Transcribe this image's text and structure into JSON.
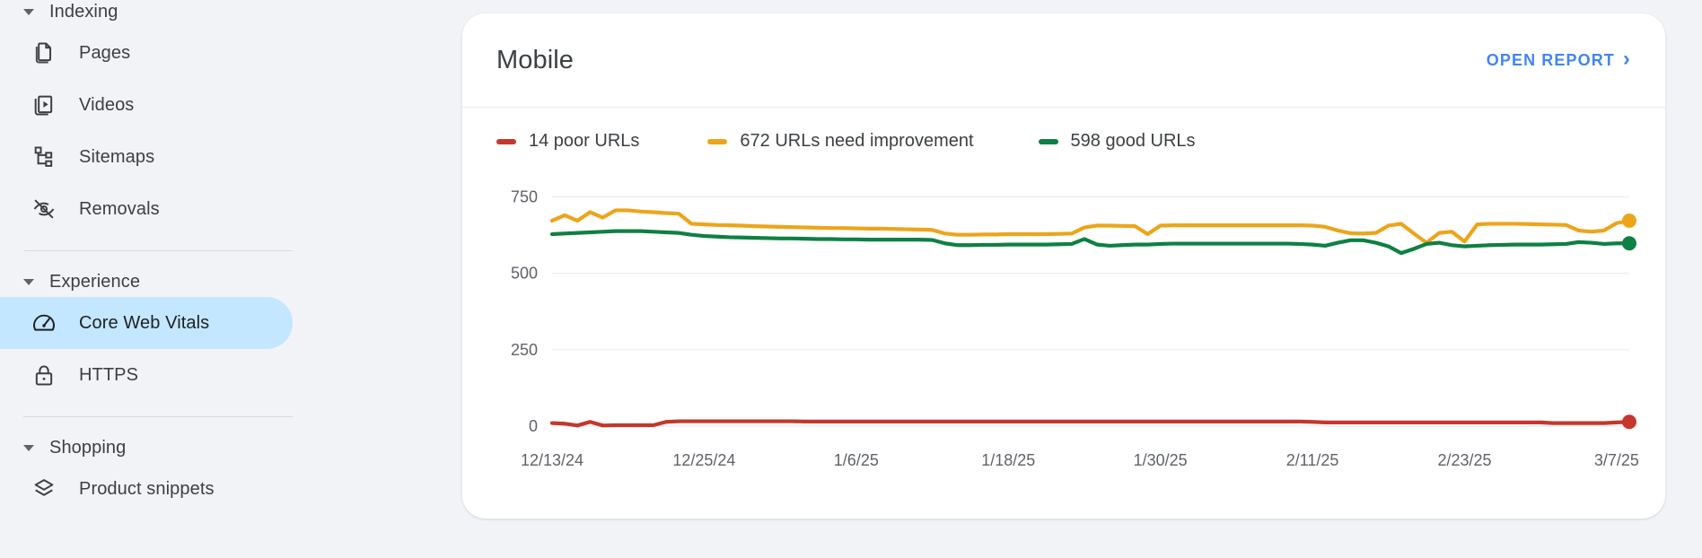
{
  "sidebar": {
    "groups": [
      {
        "name": "indexing",
        "label": "Indexing",
        "items": [
          {
            "label": "Pages",
            "icon": "pages-icon",
            "selected": false
          },
          {
            "label": "Videos",
            "icon": "videos-icon",
            "selected": false
          },
          {
            "label": "Sitemaps",
            "icon": "sitemaps-icon",
            "selected": false
          },
          {
            "label": "Removals",
            "icon": "removals-icon",
            "selected": false
          }
        ]
      },
      {
        "name": "experience",
        "label": "Experience",
        "items": [
          {
            "label": "Core Web Vitals",
            "icon": "speedometer-icon",
            "selected": true
          },
          {
            "label": "HTTPS",
            "icon": "lock-icon",
            "selected": false
          }
        ]
      },
      {
        "name": "shopping",
        "label": "Shopping",
        "items": [
          {
            "label": "Product snippets",
            "icon": "layers-icon",
            "selected": false
          }
        ]
      }
    ]
  },
  "card": {
    "title": "Mobile",
    "open_report_label": "OPEN REPORT",
    "open_report_chevron": "›"
  },
  "colors": {
    "poor": "#c5372c",
    "needs_improvement": "#eca51b",
    "good": "#0f8043",
    "link": "#4285f4",
    "selected_pill": "#c2e7ff",
    "page_bg": "#f1f3f6",
    "card_bg": "#ffffff",
    "grid": "#e8eaed",
    "tick_text": "#5f6368"
  },
  "chart_data": {
    "type": "line",
    "title": "Mobile",
    "xlabel": "",
    "ylabel": "",
    "ylim": [
      0,
      810
    ],
    "yticks": [
      0,
      250,
      500,
      750
    ],
    "grid": true,
    "legend_position": "top-left",
    "x_tick_labels": [
      "12/13/24",
      "12/25/24",
      "1/6/25",
      "1/18/25",
      "1/30/25",
      "2/11/25",
      "2/23/25",
      "3/7/25"
    ],
    "x_tick_indices": [
      0,
      12,
      24,
      36,
      48,
      60,
      72,
      84
    ],
    "end_markers": true,
    "series": [
      {
        "name": "14 poor URLs",
        "legend_label": "14 poor URLs",
        "color": "#c5372c",
        "latest_value": 14,
        "values": [
          10,
          8,
          2,
          14,
          2,
          3,
          3,
          3,
          3,
          14,
          16,
          16,
          16,
          16,
          16,
          16,
          16,
          16,
          16,
          16,
          15,
          15,
          15,
          15,
          15,
          15,
          15,
          15,
          15,
          15,
          15,
          15,
          15,
          15,
          15,
          15,
          15,
          15,
          15,
          15,
          15,
          15,
          15,
          15,
          15,
          15,
          15,
          15,
          15,
          15,
          15,
          15,
          15,
          15,
          15,
          15,
          15,
          15,
          15,
          15,
          14,
          12,
          12,
          12,
          12,
          12,
          12,
          12,
          12,
          12,
          12,
          12,
          12,
          12,
          12,
          12,
          12,
          12,
          12,
          10,
          10,
          10,
          10,
          10,
          12,
          14
        ]
      },
      {
        "name": "672 URLs need improvement",
        "legend_label": "672 URLs need improvement",
        "color": "#eca51b",
        "latest_value": 672,
        "values": [
          672,
          690,
          672,
          700,
          682,
          706,
          706,
          702,
          700,
          697,
          695,
          662,
          660,
          658,
          657,
          656,
          654,
          653,
          652,
          651,
          650,
          649,
          648,
          648,
          647,
          646,
          646,
          645,
          644,
          643,
          642,
          630,
          626,
          626,
          627,
          627,
          628,
          628,
          628,
          628,
          629,
          630,
          650,
          656,
          656,
          655,
          654,
          628,
          656,
          657,
          657,
          657,
          657,
          657,
          657,
          657,
          657,
          657,
          657,
          657,
          656,
          652,
          640,
          631,
          630,
          632,
          656,
          662,
          630,
          600,
          632,
          636,
          604,
          660,
          662,
          662,
          662,
          661,
          660,
          659,
          658,
          640,
          636,
          640,
          664,
          672
        ]
      },
      {
        "name": "598 good URLs",
        "legend_label": "598 good URLs",
        "color": "#0f8043",
        "latest_value": 598,
        "values": [
          628,
          630,
          632,
          634,
          636,
          638,
          638,
          638,
          636,
          634,
          632,
          626,
          622,
          620,
          618,
          617,
          616,
          615,
          614,
          614,
          613,
          612,
          612,
          611,
          611,
          610,
          610,
          610,
          610,
          610,
          609,
          598,
          592,
          592,
          593,
          593,
          594,
          594,
          594,
          594,
          595,
          596,
          612,
          594,
          590,
          592,
          594,
          594,
          596,
          597,
          597,
          597,
          597,
          597,
          597,
          597,
          597,
          597,
          597,
          596,
          594,
          590,
          600,
          608,
          608,
          600,
          588,
          566,
          580,
          596,
          600,
          592,
          588,
          590,
          592,
          593,
          594,
          594,
          594,
          595,
          596,
          602,
          600,
          596,
          598,
          598
        ]
      }
    ]
  }
}
